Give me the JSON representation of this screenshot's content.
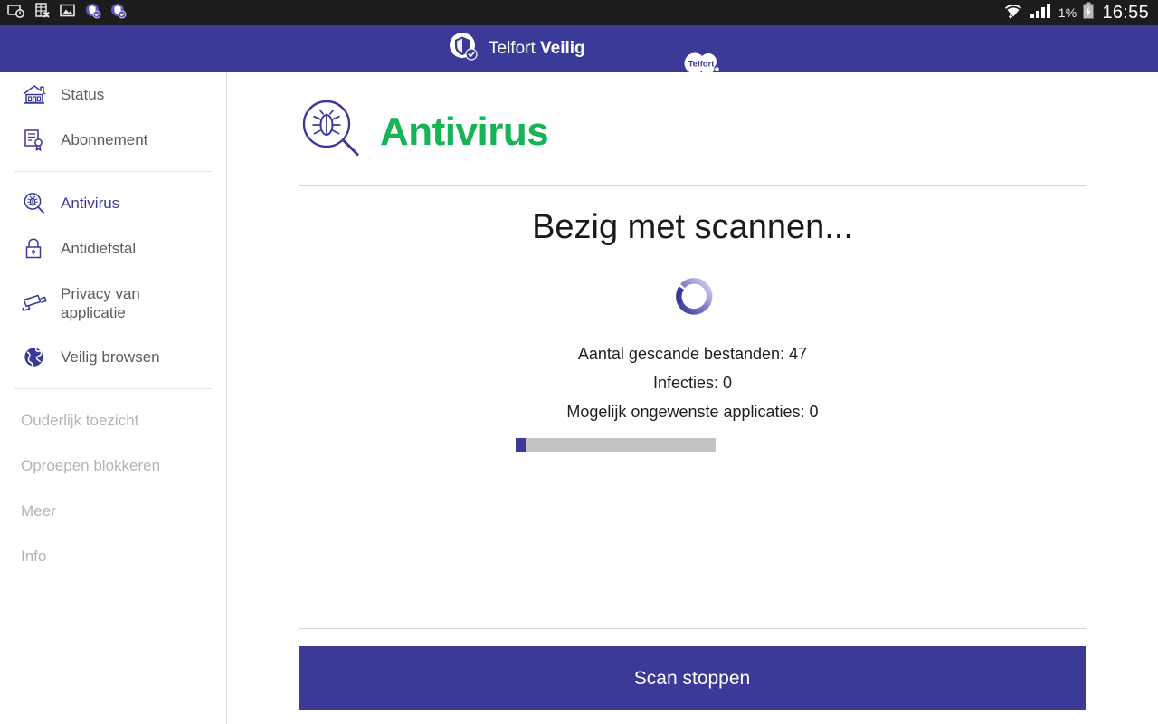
{
  "statusbar": {
    "left_icons": [
      {
        "name": "screenshot-history-icon"
      },
      {
        "name": "spreadsheet-error-icon"
      },
      {
        "name": "image-icon"
      },
      {
        "name": "shield-check-notification-icon-1"
      },
      {
        "name": "shield-check-notification-icon-2"
      }
    ],
    "wifi_icon": "wifi-icon",
    "signal_icon": "cellular-signal-icon",
    "battery_percent": "1%",
    "battery_icon": "battery-charging-icon",
    "clock": "16:55"
  },
  "header": {
    "logo_icon": "telfort-veilig-shield-icon",
    "brand_prefix": "Telfort ",
    "brand_suffix": "Veilig",
    "partner_logo_text": "Telfort",
    "partner_logo_icon": "telfort-cloud-logo"
  },
  "sidebar": {
    "groups": [
      {
        "items": [
          {
            "label": "Status",
            "icon": "home-icon",
            "state": "normal"
          },
          {
            "label": "Abonnement",
            "icon": "subscription-certificate-icon",
            "state": "normal"
          }
        ]
      },
      {
        "items": [
          {
            "label": "Antivirus",
            "icon": "bug-magnifier-icon",
            "state": "active"
          },
          {
            "label": "Antidiefstal",
            "icon": "padlock-icon",
            "state": "normal"
          },
          {
            "label": "Privacy van\napplicatie",
            "icon": "security-camera-icon",
            "state": "normal"
          },
          {
            "label": "Veilig browsen",
            "icon": "globe-icon",
            "state": "normal"
          }
        ]
      },
      {
        "items": [
          {
            "label": "Ouderlijk toezicht",
            "icon": "none",
            "state": "disabled"
          },
          {
            "label": "Oproepen blokkeren",
            "icon": "none",
            "state": "disabled"
          },
          {
            "label": "Meer",
            "icon": "none",
            "state": "disabled"
          },
          {
            "label": "Info",
            "icon": "none",
            "state": "disabled"
          }
        ]
      }
    ]
  },
  "main": {
    "title": "Antivirus",
    "title_icon": "bug-magnifier-icon",
    "scan_status": "Bezig met scannen...",
    "spinner_icon": "loading-spinner-icon",
    "stats": [
      "Aantal gescande bestanden: 47",
      "Infecties: 0",
      "Mogelijk ongewenste applicaties: 0"
    ],
    "progress_percent": 5,
    "stop_button_label": "Scan stoppen"
  },
  "colors": {
    "brand_indigo": "#3b3a98",
    "title_green": "#16b357",
    "statusbar_black": "#1c1c1c",
    "progress_track": "#c3c3c3",
    "disabled_text": "#b4b4b4"
  }
}
